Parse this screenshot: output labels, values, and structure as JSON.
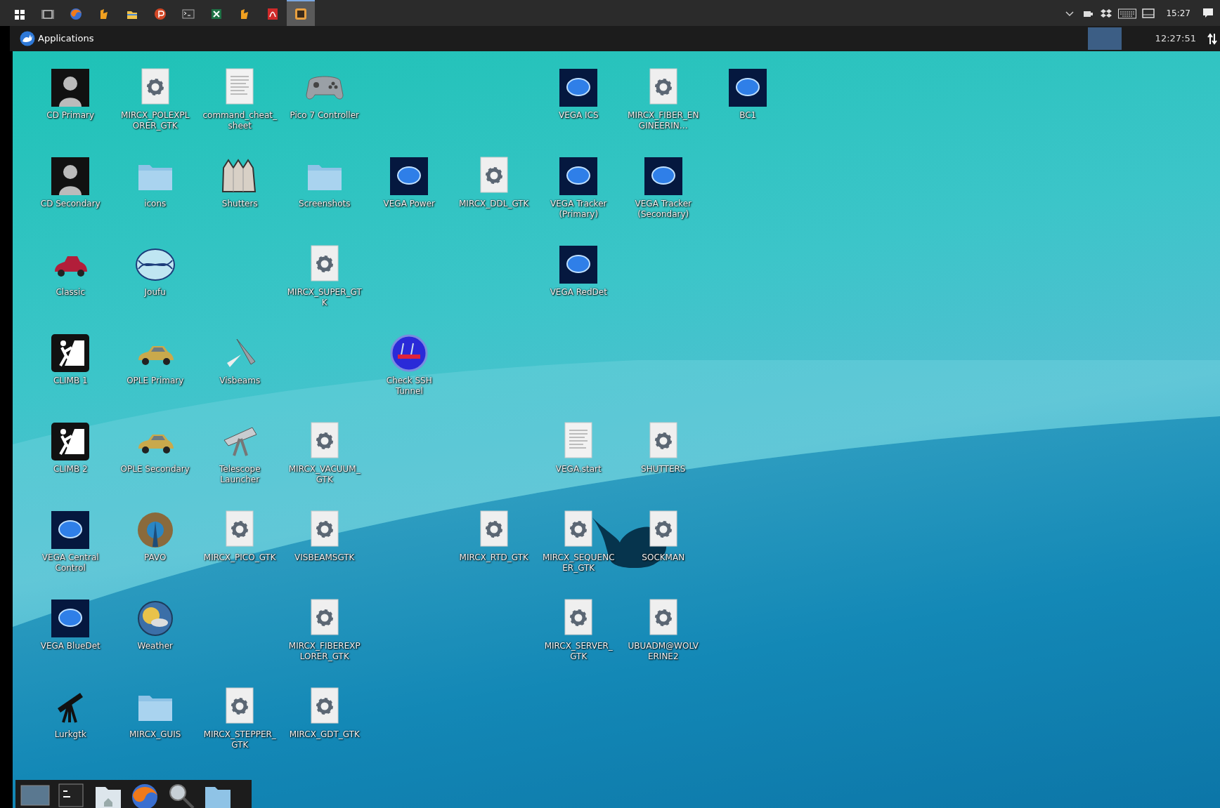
{
  "taskbar": {
    "apps": [
      {
        "kind": "windows",
        "selected": false
      },
      {
        "kind": "taskview",
        "selected": false
      },
      {
        "kind": "firefox",
        "selected": false
      },
      {
        "kind": "java",
        "selected": false
      },
      {
        "kind": "explorer",
        "selected": false
      },
      {
        "kind": "powerpoint",
        "selected": false
      },
      {
        "kind": "terminal",
        "selected": false
      },
      {
        "kind": "excel",
        "selected": false
      },
      {
        "kind": "java",
        "selected": false
      },
      {
        "kind": "pdf",
        "selected": false
      },
      {
        "kind": "viewer",
        "selected": true
      }
    ],
    "tray": [
      {
        "kind": "chevron"
      },
      {
        "kind": "power"
      },
      {
        "kind": "dropbox"
      },
      {
        "kind": "keyboard"
      },
      {
        "kind": "display"
      }
    ],
    "clock": "15:27"
  },
  "panel": {
    "menu_label": "Applications",
    "clock": "12:27:51"
  },
  "desktop": {
    "rows": [
      [
        {
          "label": "CD Primary",
          "kind": "portrait"
        },
        {
          "label": "MIRCX_POLEXPLORER_GTK",
          "kind": "gear"
        },
        {
          "label": "command_cheat_sheet",
          "kind": "document"
        },
        {
          "label": "Pico 7 Controller",
          "kind": "gamepad"
        },
        null,
        null,
        {
          "label": "VEGA ICS",
          "kind": "vega"
        },
        {
          "label": "MIRCX_FIBER_ENGINEERIN…",
          "kind": "gear"
        },
        {
          "label": "BC1",
          "kind": "vega"
        }
      ],
      [
        {
          "label": "CD Secondary",
          "kind": "portrait"
        },
        {
          "label": "icons",
          "kind": "folder"
        },
        {
          "label": "Shutters",
          "kind": "shutters"
        },
        {
          "label": "Screenshots",
          "kind": "folder"
        },
        {
          "label": "VEGA Power",
          "kind": "vega"
        },
        {
          "label": "MIRCX_DDL_GTK",
          "kind": "gear"
        },
        {
          "label": "VEGA Tracker (Primary)",
          "kind": "vega"
        },
        {
          "label": "VEGA Tracker (Secondary)",
          "kind": "vega"
        }
      ],
      [
        {
          "label": "Classic",
          "kind": "roadster"
        },
        {
          "label": "Joufu",
          "kind": "joufu"
        },
        null,
        {
          "label": "MIRCX_SUPER_GTK",
          "kind": "gear"
        },
        null,
        null,
        {
          "label": "VEGA RedDet",
          "kind": "vega"
        }
      ],
      [
        {
          "label": "CLIMB 1",
          "kind": "climb"
        },
        {
          "label": "OPLE Primary",
          "kind": "coupe"
        },
        {
          "label": "Visbeams",
          "kind": "satellite"
        },
        null,
        {
          "label": "Check SSH Tunnel",
          "kind": "emblem"
        }
      ],
      [
        {
          "label": "CLIMB 2",
          "kind": "climb"
        },
        {
          "label": "OPLE Secondary",
          "kind": "coupe"
        },
        {
          "label": "Telescope Launcher",
          "kind": "telescope"
        },
        {
          "label": "MIRCX_VACUUM_GTK",
          "kind": "gear"
        },
        null,
        null,
        {
          "label": "VEGA.start",
          "kind": "document"
        },
        {
          "label": "SHUTTERS",
          "kind": "gear"
        }
      ],
      [
        {
          "label": "VEGA Central Control",
          "kind": "vega"
        },
        {
          "label": "PAVO",
          "kind": "pavo"
        },
        {
          "label": "MIRCX_PICO_GTK",
          "kind": "gear"
        },
        {
          "label": "VISBEAMSGTK",
          "kind": "gear"
        },
        null,
        {
          "label": "MIRCX_RTD_GTK",
          "kind": "gear"
        },
        {
          "label": "MIRCX_SEQUENCER_GTK",
          "kind": "gear"
        },
        {
          "label": "SOCKMAN",
          "kind": "gear"
        }
      ],
      [
        {
          "label": "VEGA BlueDet",
          "kind": "vega"
        },
        {
          "label": "Weather",
          "kind": "weather"
        },
        null,
        {
          "label": "MIRCX_FIBEREXPLORER_GTK",
          "kind": "gear"
        },
        null,
        null,
        {
          "label": "MIRCX_SERVER_GTK",
          "kind": "gear"
        },
        {
          "label": "UBUADM@WOLVERINE2",
          "kind": "gear"
        }
      ],
      [
        {
          "label": "Lurkgtk",
          "kind": "reflector"
        },
        {
          "label": "MIRCX_GUIS",
          "kind": "folder"
        },
        {
          "label": "MIRCX_STEPPER_GTK",
          "kind": "gear"
        },
        {
          "label": "MIRCX_GDT_GTK",
          "kind": "gear"
        }
      ]
    ]
  },
  "dock": {
    "launchers": [
      {
        "kind": "desktop"
      },
      {
        "kind": "terminal"
      },
      {
        "kind": "home"
      },
      {
        "kind": "firefox"
      },
      {
        "kind": "search"
      },
      {
        "kind": "folder"
      }
    ]
  }
}
